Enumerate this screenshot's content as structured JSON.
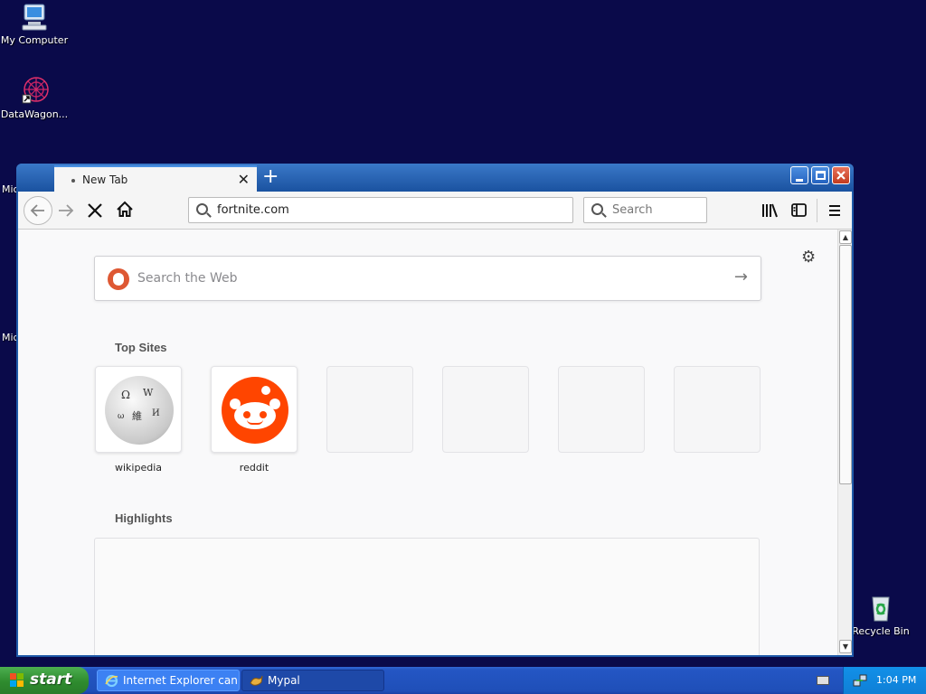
{
  "desktop": {
    "icons": [
      {
        "label": "My Computer"
      },
      {
        "label": "DataWagon..."
      },
      {
        "label": "Recycle Bin"
      }
    ],
    "partial_labels": [
      "Mic",
      "Mic"
    ]
  },
  "browser": {
    "tab_title": "New Tab",
    "address": "fortnite.com",
    "search_placeholder": "Search",
    "web_search_placeholder": "Search the Web",
    "top_sites_heading": "Top Sites",
    "top_sites": [
      {
        "label": "wikipedia",
        "icon": "wikipedia-globe-icon"
      },
      {
        "label": "reddit",
        "icon": "reddit-alien-icon"
      }
    ],
    "empty_tiles": 4,
    "highlights_heading": "Highlights"
  },
  "taskbar": {
    "start_label": "start",
    "items": [
      {
        "label": "Internet Explorer can...",
        "active": true
      },
      {
        "label": "Mypal",
        "active": false
      }
    ],
    "clock": "1:04 PM"
  },
  "colors": {
    "desktop_bg": "#0a0a4a",
    "reddit": "#ff4500",
    "titlebar": "#1f5aa8"
  }
}
